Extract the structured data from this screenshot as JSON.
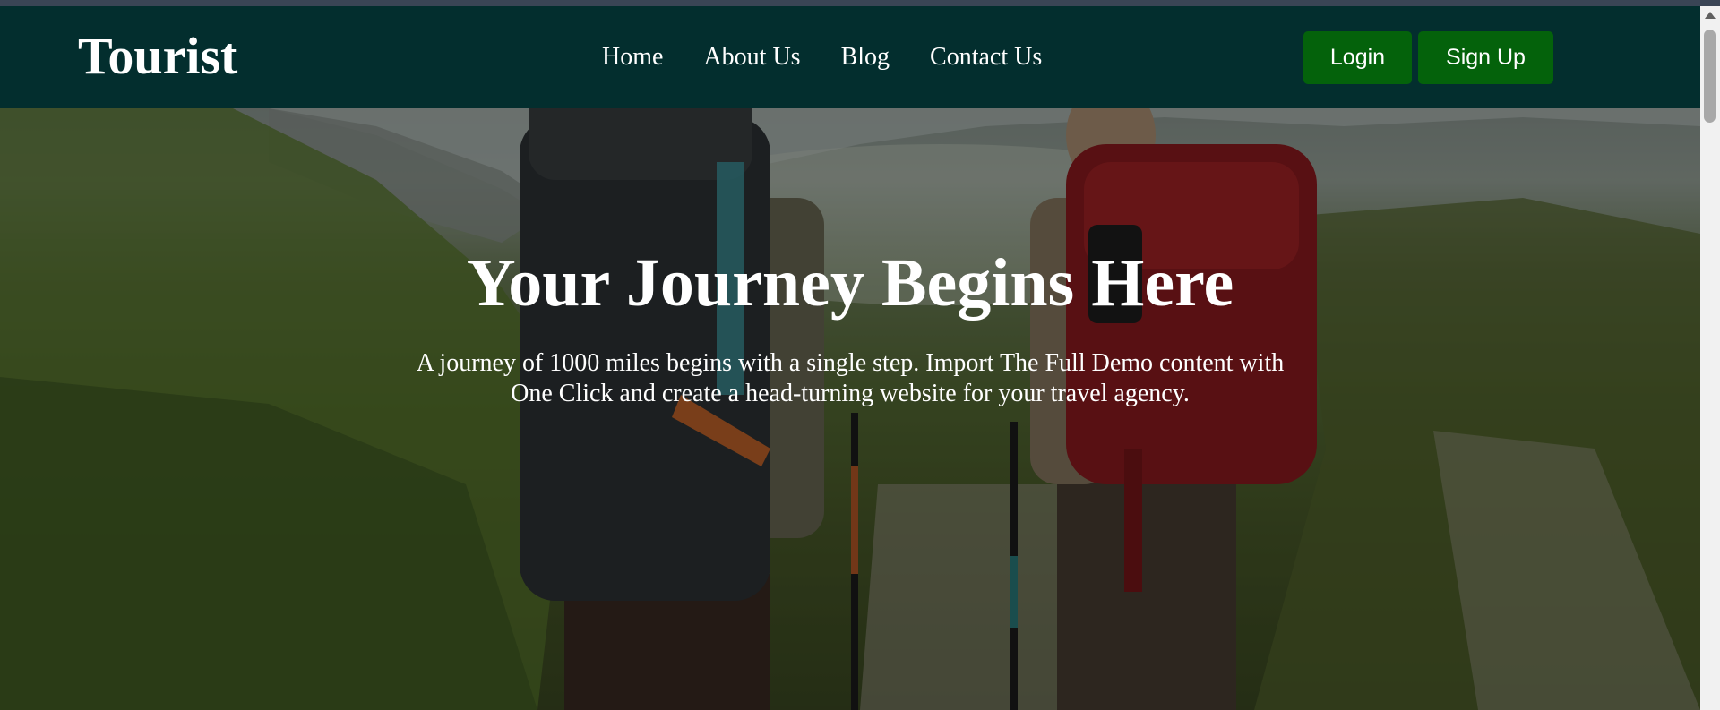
{
  "nav": {
    "logo": "Tourist",
    "links": [
      "Home",
      "About Us",
      "Blog",
      "Contact Us"
    ],
    "buttons": {
      "login": "Login",
      "signup": "Sign Up"
    }
  },
  "hero": {
    "title": "Your Journey Begins Here",
    "subtitle": "A journey of 1000 miles begins with a single step. Import The Full Demo content with One Click and create a head-turning website for your travel agency."
  },
  "colors": {
    "navbar_bg": "#032e2e",
    "button_bg": "#04620b",
    "text": "#ffffff"
  }
}
